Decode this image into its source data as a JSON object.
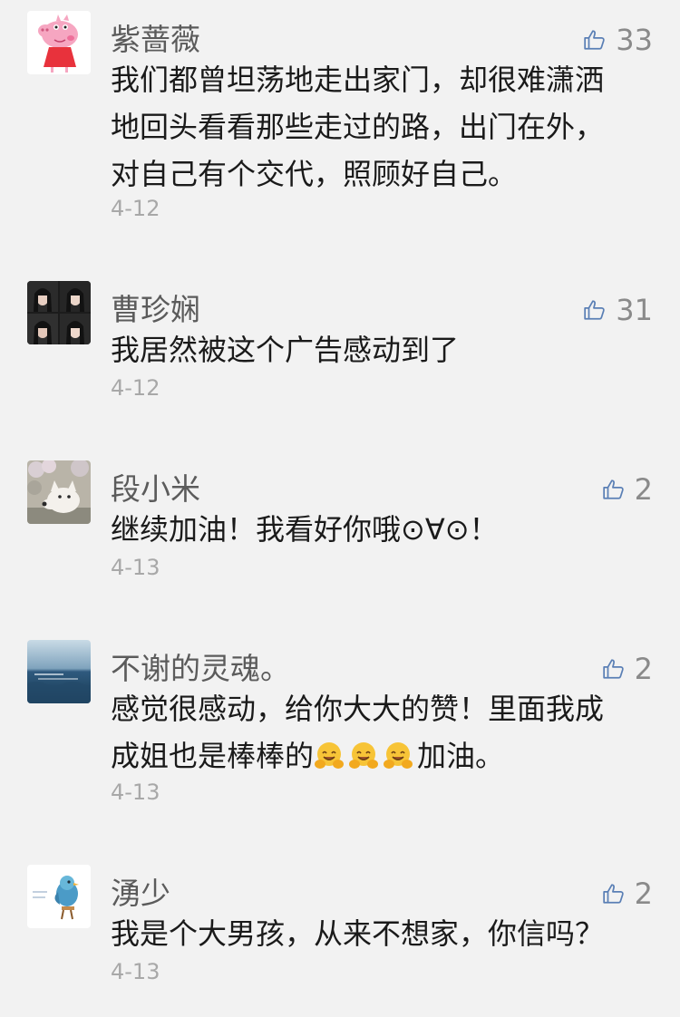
{
  "comments": [
    {
      "name": "紫蔷薇",
      "likes": "33",
      "lines": [
        "我们都曾坦荡地走出家门，却很难潇洒",
        "地回头看看那些走过的路，出门在外，",
        "对自己有个交代，照顾好自己。"
      ],
      "date": "4-12",
      "avatar": "peppa-pig-avatar"
    },
    {
      "name": "曹珍娴",
      "likes": "31",
      "lines": [
        "我居然被这个广告感动到了"
      ],
      "date": "4-12",
      "avatar": "photo-grid-avatar"
    },
    {
      "name": "段小米",
      "likes": "2",
      "lines": [
        "继续加油！我看好你哦⊙∀⊙！"
      ],
      "date": "4-13",
      "avatar": "dog-avatar"
    },
    {
      "name": "不谢的灵魂。",
      "likes": "2",
      "lines": [
        "感觉很感动，给你大大的赞！里面我成",
        "成姐也是棒棒的"
      ],
      "line2_suffix": "加油。",
      "emoji": "hugging-face-emoji",
      "date": "4-13",
      "avatar": "ocean-avatar"
    },
    {
      "name": "湧少",
      "likes": "2",
      "lines": [
        "我是个大男孩，从来不想家，你信吗？"
      ],
      "date": "4-13",
      "avatar": "bird-illustration-avatar"
    }
  ],
  "colors": {
    "background": "#f2f2f2",
    "name": "#5b5b5b",
    "text": "#1a1a1a",
    "date": "#a8a8a8",
    "like": "#8a8a8a"
  },
  "icons": {
    "like": "thumbs-up-icon"
  }
}
